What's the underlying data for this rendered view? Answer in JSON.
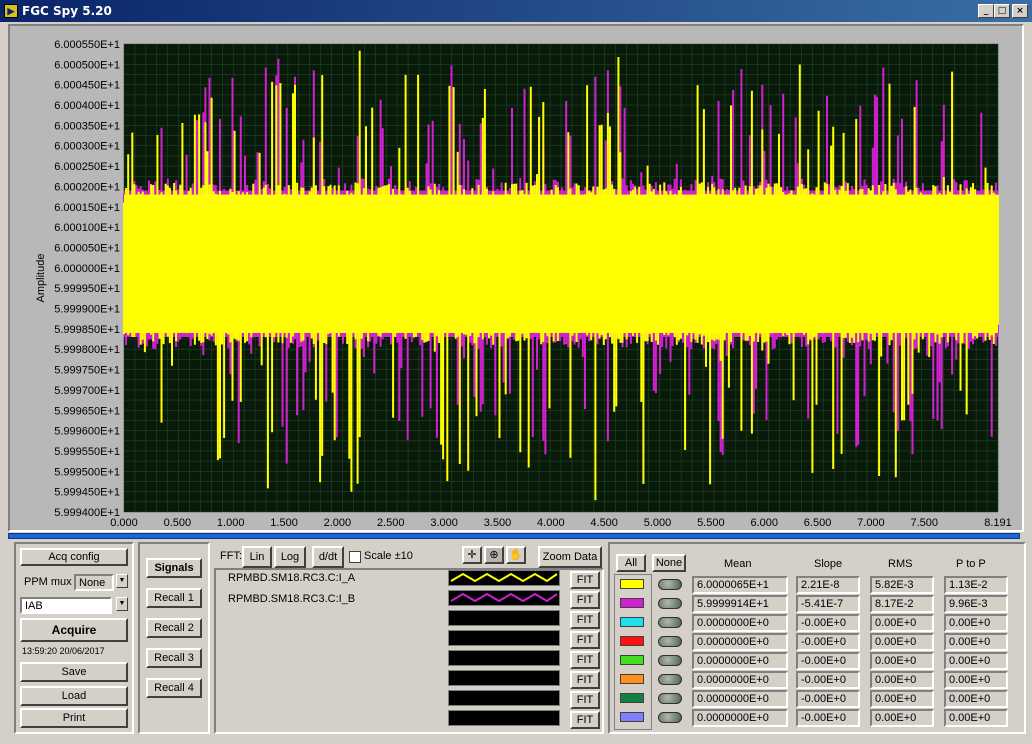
{
  "window": {
    "title": "FGC Spy 5.20",
    "icon_name": "app-icon",
    "controls": [
      "minimize-icon",
      "maximize-icon",
      "close-icon"
    ]
  },
  "plot": {
    "ylabel": "Amplitude",
    "y_ticks": [
      "6.000550E+1",
      "6.000500E+1",
      "6.000450E+1",
      "6.000400E+1",
      "6.000350E+1",
      "6.000300E+1",
      "6.000250E+1",
      "6.000200E+1",
      "6.000150E+1",
      "6.000100E+1",
      "6.000050E+1",
      "6.000000E+1",
      "5.999950E+1",
      "5.999900E+1",
      "5.999850E+1",
      "5.999800E+1",
      "5.999750E+1",
      "5.999700E+1",
      "5.999650E+1",
      "5.999600E+1",
      "5.999550E+1",
      "5.999500E+1",
      "5.999450E+1",
      "5.999400E+1"
    ],
    "x_ticks": [
      "0.000",
      "0.500",
      "1.000",
      "1.500",
      "2.000",
      "2.500",
      "3.000",
      "3.500",
      "4.000",
      "4.500",
      "5.000",
      "5.500",
      "6.000",
      "6.500",
      "7.000",
      "7.500",
      "8.191"
    ],
    "colors": {
      "background": "#0a1a0a",
      "grid": "#1c4a24",
      "series_a": "#ffff00",
      "series_b": "#d020d0"
    }
  },
  "chart_data": {
    "type": "line",
    "xlim": [
      0,
      8.191
    ],
    "ylim": [
      59.994,
      60.0055
    ],
    "ylabel": "Amplitude",
    "grid": true,
    "series": [
      {
        "name": "RPMBD.SM18.RC3.C:I_A",
        "color": "#ffff00",
        "center": 60.000065,
        "envelope": [
          59.9981,
          60.0021
        ],
        "spikes_range": [
          59.9942,
          60.0055
        ]
      },
      {
        "name": "RPMBD.SM18.RC3.C:I_B",
        "color": "#d020d0",
        "center": 59.999914,
        "envelope": [
          59.998,
          60.0022
        ],
        "spikes_range": [
          59.9951,
          60.0052
        ]
      }
    ]
  },
  "controls": {
    "acq_config": "Acq config",
    "ppm_mux_label": "PPM mux",
    "ppm_mux_value": "None",
    "signal_value": "IAB",
    "acquire": "Acquire",
    "timestamp": "13:59:20 20/06/2017",
    "save": "Save",
    "load": "Load",
    "print": "Print"
  },
  "recall": {
    "signals": "Signals",
    "items": [
      "Recall 1",
      "Recall 2",
      "Recall 3",
      "Recall 4"
    ]
  },
  "toolbar": {
    "fft_label": "FFT:",
    "lin": "Lin",
    "log": "Log",
    "ddt": "d/dt",
    "scale_label": "Scale ±10",
    "zoom_data": "Zoom Data",
    "tool_icons": [
      "crosshair-icon",
      "zoom-icon",
      "pan-hand-icon"
    ]
  },
  "signals": {
    "names": [
      "RPMBD.SM18.RC3.C:I_A",
      "RPMBD.SM18.RC3.C:I_B"
    ],
    "fit_label": "FIT"
  },
  "stats": {
    "all": "All",
    "none": "None",
    "headers": {
      "mean": "Mean",
      "slope": "Slope",
      "rms": "RMS",
      "ptp": "P to P"
    },
    "rows": [
      {
        "color": "#ffff00",
        "mean": "6.0000065E+1",
        "slope": "2.21E-8",
        "rms": "5.82E-3",
        "ptp": "1.13E-2"
      },
      {
        "color": "#d020d0",
        "mean": "5.9999914E+1",
        "slope": "-5.41E-7",
        "rms": "8.17E-2",
        "ptp": "9.96E-3"
      },
      {
        "color": "#20e0f0",
        "mean": "0.0000000E+0",
        "slope": "-0.00E+0",
        "rms": "0.00E+0",
        "ptp": "0.00E+0"
      },
      {
        "color": "#ff1010",
        "mean": "0.0000000E+0",
        "slope": "-0.00E+0",
        "rms": "0.00E+0",
        "ptp": "0.00E+0"
      },
      {
        "color": "#40e020",
        "mean": "0.0000000E+0",
        "slope": "-0.00E+0",
        "rms": "0.00E+0",
        "ptp": "0.00E+0"
      },
      {
        "color": "#ff9020",
        "mean": "0.0000000E+0",
        "slope": "-0.00E+0",
        "rms": "0.00E+0",
        "ptp": "0.00E+0"
      },
      {
        "color": "#108040",
        "mean": "0.0000000E+0",
        "slope": "-0.00E+0",
        "rms": "0.00E+0",
        "ptp": "0.00E+0"
      },
      {
        "color": "#8080ff",
        "mean": "0.0000000E+0",
        "slope": "-0.00E+0",
        "rms": "0.00E+0",
        "ptp": "0.00E+0"
      }
    ]
  }
}
